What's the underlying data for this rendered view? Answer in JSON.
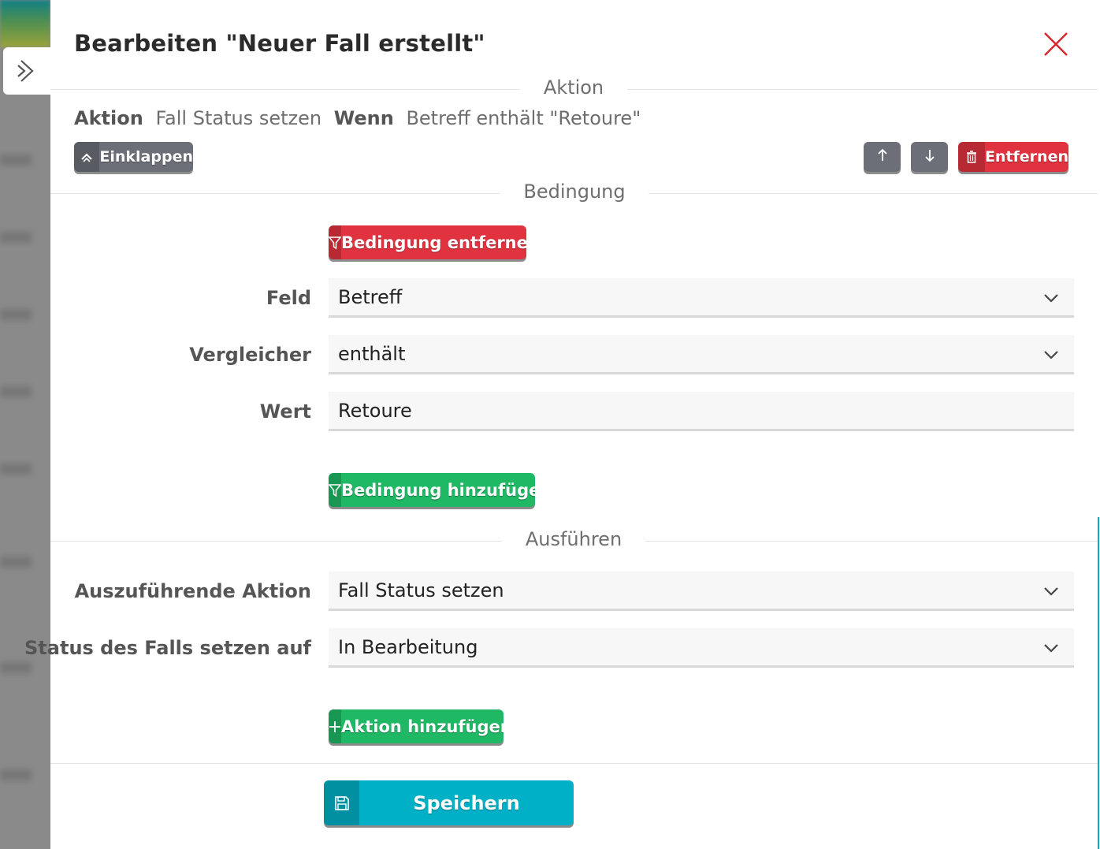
{
  "dialog": {
    "title": "Bearbeiten \"Neuer Fall erstellt\"",
    "close_icon": "close-icon"
  },
  "sections": {
    "aktion": "Aktion",
    "bedingung": "Bedingung",
    "ausfuehren": "Ausführen"
  },
  "summary": {
    "kw_action": "Aktion",
    "action_value": "Fall Status setzen",
    "kw_when": "Wenn",
    "when_value": "Betreff enthält \"Retoure\""
  },
  "toolbar": {
    "collapse_label": "Einklappen",
    "remove_label": "Entfernen",
    "up_icon": "arrow-up-icon",
    "down_icon": "arrow-down-icon"
  },
  "condition": {
    "remove_label": "Bedingung entfernen",
    "field_label": "Feld",
    "field_value": "Betreff",
    "comparator_label": "Vergleicher",
    "comparator_value": "enthält",
    "value_label": "Wert",
    "value_value": "Retoure",
    "add_label": "Bedingung hinzufügen"
  },
  "execute": {
    "action_label": "Auszuführende Aktion",
    "action_value": "Fall Status setzen",
    "status_label": "Status des Falls setzen auf",
    "status_value": "In Bearbeitung",
    "add_label": "Aktion hinzufügen"
  },
  "footer": {
    "save_label": "Speichern"
  },
  "colors": {
    "red": "#e0323f",
    "green": "#1fb864",
    "teal": "#00b0c6",
    "gray": "#6c6f77"
  }
}
